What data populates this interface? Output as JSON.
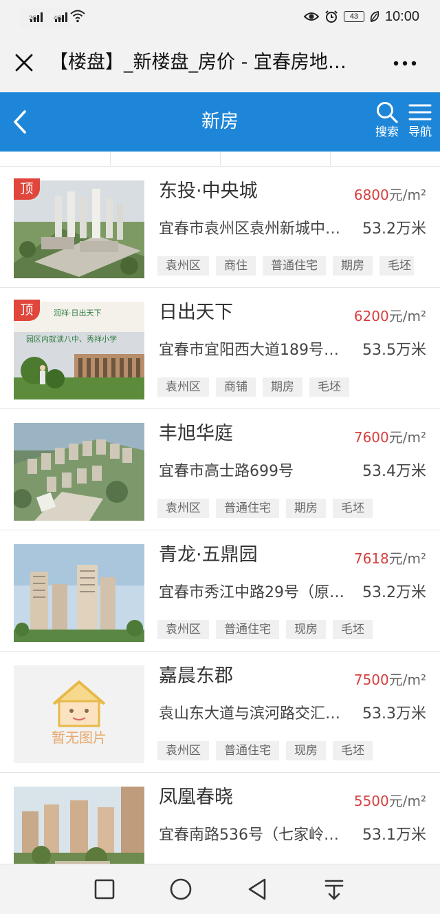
{
  "status_bar": {
    "network_1": "2G",
    "network_2": "4G",
    "battery": "43",
    "time": "10:00"
  },
  "browser": {
    "title": "【楼盘】_新楼盘_房价 - 宜春房地…"
  },
  "header": {
    "title": "新房",
    "search_label": "搜索",
    "nav_label": "导航"
  },
  "price_unit": "元/m²",
  "listings": [
    {
      "name": "东投·中央城",
      "price": "6800",
      "address": "宜春市袁州区袁州新城中…",
      "area": "53.2万米",
      "tags": [
        "袁州区",
        "商住",
        "普通住宅",
        "期房",
        "毛坯"
      ],
      "badge": "顶"
    },
    {
      "name": "日出天下",
      "price": "6200",
      "address": "宜春市宜阳西大道189号…",
      "area": "53.5万米",
      "tags": [
        "袁州区",
        "商铺",
        "期房",
        "毛坯"
      ],
      "badge": "顶",
      "image_text": [
        "润祥·日出天下",
        "园区内就读八中、秀祥小学"
      ]
    },
    {
      "name": "丰旭华庭",
      "price": "7600",
      "address": "宜春市高士路699号",
      "area": "53.4万米",
      "tags": [
        "袁州区",
        "普通住宅",
        "期房",
        "毛坯"
      ]
    },
    {
      "name": "青龙·五鼎园",
      "price": "7618",
      "address": "宜春市秀江中路29号（原…",
      "area": "53.2万米",
      "tags": [
        "袁州区",
        "普通住宅",
        "现房",
        "毛坯"
      ]
    },
    {
      "name": "嘉晨东郡",
      "price": "7500",
      "address": "袁山东大道与滨河路交汇…",
      "area": "53.3万米",
      "tags": [
        "袁州区",
        "普通住宅",
        "现房",
        "毛坯"
      ],
      "no_image_text": "暂无图片"
    },
    {
      "name": "凤凰春晓",
      "price": "5500",
      "address": "宜春南路536号（七家岭…",
      "area": "53.1万米",
      "tags": []
    }
  ],
  "colors": {
    "header_blue": "#1e86d8",
    "price_red": "#d64040",
    "badge_red": "#e0463c"
  }
}
